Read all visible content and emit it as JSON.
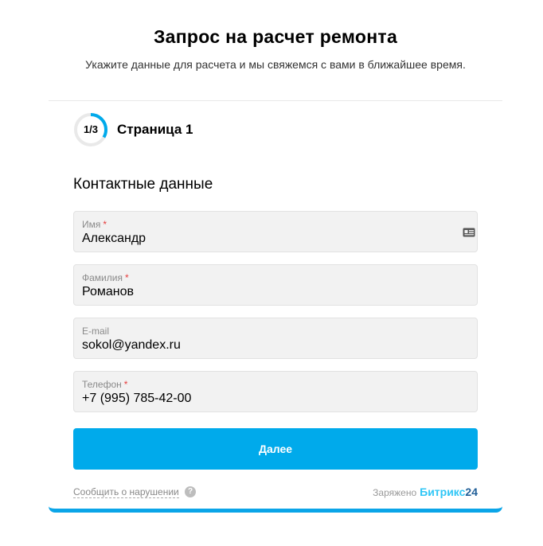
{
  "header": {
    "title": "Запрос на расчет ремонта",
    "subtitle": "Укажите данные для расчета и мы свяжемся с вами в ближайшее время."
  },
  "progress": {
    "text": "1/3",
    "current": 1,
    "total": 3
  },
  "page": {
    "label": "Страница 1"
  },
  "section": {
    "title": "Контактные данные"
  },
  "fields": [
    {
      "label": "Имя",
      "required": "*",
      "value": "Александр"
    },
    {
      "label": "Фамилия",
      "required": "*",
      "value": "Романов"
    },
    {
      "label": "E-mail",
      "required": "",
      "value": "sokol@yandex.ru"
    },
    {
      "label": "Телефон",
      "required": "*",
      "value": "+7 (995) 785-42-00"
    }
  ],
  "actions": {
    "next_label": "Далее"
  },
  "footer": {
    "report_label": "Сообщить о нарушении",
    "help_icon": "?",
    "powered_label": "Заряжено",
    "brand_name": "Битрикс",
    "brand_number": "24"
  },
  "colors": {
    "accent": "#00aaeb",
    "progress_track": "#e9e9e9",
    "required": "#e63c3c",
    "brand_light": "#2fc6f6",
    "brand_dark": "#215f98"
  }
}
